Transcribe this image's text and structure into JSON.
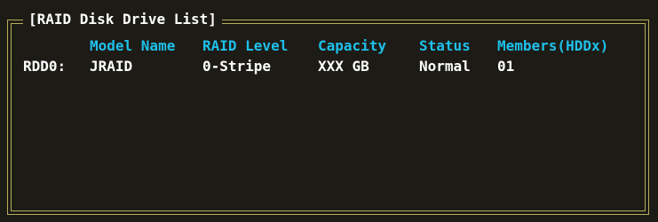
{
  "window": {
    "title": "[RAID Disk Drive List]"
  },
  "columns": {
    "model_name": "Model Name",
    "raid_level": "RAID Level",
    "capacity": "Capacity",
    "status": "Status",
    "members": "Members(HDDx)"
  },
  "drives": [
    {
      "id": "RDD0:",
      "model_name": "JRAID",
      "raid_level": "0-Stripe",
      "capacity": "XXX GB",
      "status": "Normal",
      "members": "01"
    }
  ],
  "colors": {
    "background": "#1d1b16",
    "border": "#b8ad58",
    "header_text": "#1ec0ea",
    "value_text": "#ffffff"
  }
}
